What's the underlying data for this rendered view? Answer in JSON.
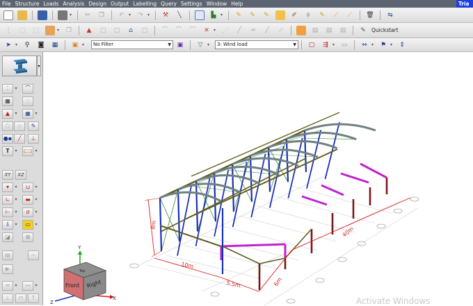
{
  "menubar": {
    "items": [
      "File",
      "Structure",
      "Loads",
      "Analysis",
      "Design",
      "Output",
      "Labelling",
      "Query",
      "Settings",
      "Window",
      "Help"
    ],
    "right_label": "Tria"
  },
  "toolbar3": {
    "filter_value": "No Filter",
    "loadcase_value": "3: Wind load"
  },
  "toolbar2": {
    "quickstart_label": "Quickstart"
  },
  "sidebar": {
    "xy_label": "XY",
    "xz_label": "XZ"
  },
  "viewport": {
    "dimension_labels": [
      "8m",
      "10m",
      "5.5m",
      "6m",
      "40m"
    ],
    "view_cube": {
      "front_label": "Front",
      "right_label": "Right",
      "top_label": "Top",
      "axis_y": "Y",
      "axis_x": "X",
      "axis_z": "Z"
    }
  },
  "watermark": "Activate Windows",
  "colors": {
    "column_blue": "#1a2fb8",
    "beam_olive": "#5f5c1e",
    "brace_green": "#2f8a3a",
    "purple_frame": "#c020d0",
    "maroon_column": "#7a1818",
    "dimension_red": "#e01818",
    "truss_gray": "#6f7f7f"
  }
}
